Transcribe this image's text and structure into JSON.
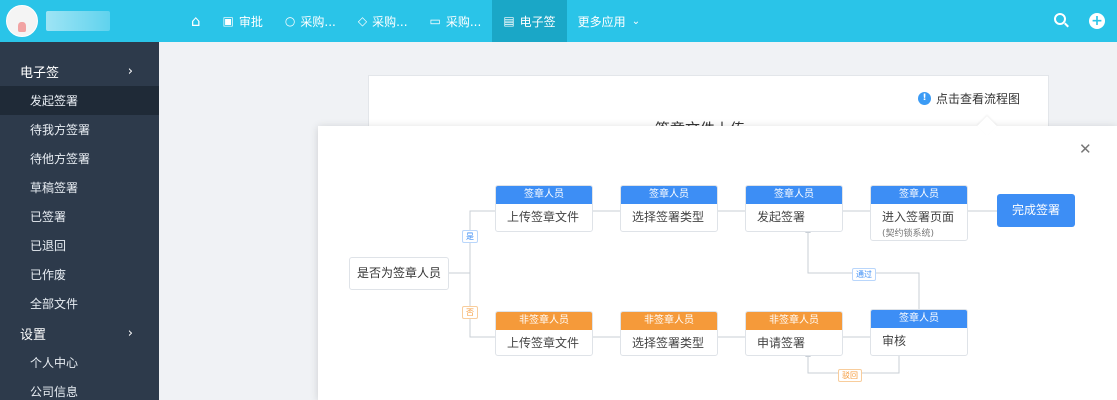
{
  "topbar": {
    "nav": [
      {
        "label": "",
        "icon": "home-icon"
      },
      {
        "label": "审批",
        "icon": "approval-icon"
      },
      {
        "label": "采购...",
        "icon": "circle-icon"
      },
      {
        "label": "采购...",
        "icon": "tag-icon"
      },
      {
        "label": "采购...",
        "icon": "box-icon"
      },
      {
        "label": "电子签",
        "icon": "document-icon"
      },
      {
        "label": "更多应用",
        "icon": "chevron-down-icon"
      }
    ],
    "accent_color": "#2ac4e8",
    "active_nav_color": "#1aa7c7"
  },
  "sidebar": {
    "groups": [
      {
        "label": "电子签",
        "items": [
          "发起签署",
          "待我方签署",
          "待他方签署",
          "草稿签署",
          "已签署",
          "已退回",
          "已作废",
          "全部文件"
        ]
      },
      {
        "label": "设置",
        "items": [
          "个人中心",
          "公司信息"
        ]
      }
    ],
    "bg_color": "#2d3a4b"
  },
  "page": {
    "flow_link": "点击查看流程图",
    "card_title": "签章文件上传"
  },
  "flow": {
    "start": "是否为签章人员",
    "yes": "是",
    "no": "否",
    "pass": "通过",
    "reject": "驳回",
    "done": "完成签署",
    "top_row": [
      {
        "header": "签章人员",
        "body": "上传签章文件"
      },
      {
        "header": "签章人员",
        "body": "选择签署类型"
      },
      {
        "header": "签章人员",
        "body": "发起签署"
      },
      {
        "header": "签章人员",
        "body": "进入签署页面",
        "sub": "(契约锁系统)"
      }
    ],
    "bottom_row": [
      {
        "header": "非签章人员",
        "body": "上传签章文件"
      },
      {
        "header": "非签章人员",
        "body": "选择签署类型"
      },
      {
        "header": "非签章人员",
        "body": "申请签署"
      },
      {
        "header": "签章人员",
        "body": "审核"
      }
    ],
    "colors": {
      "blue": "#3d8ef5",
      "orange": "#f59a3a"
    }
  }
}
